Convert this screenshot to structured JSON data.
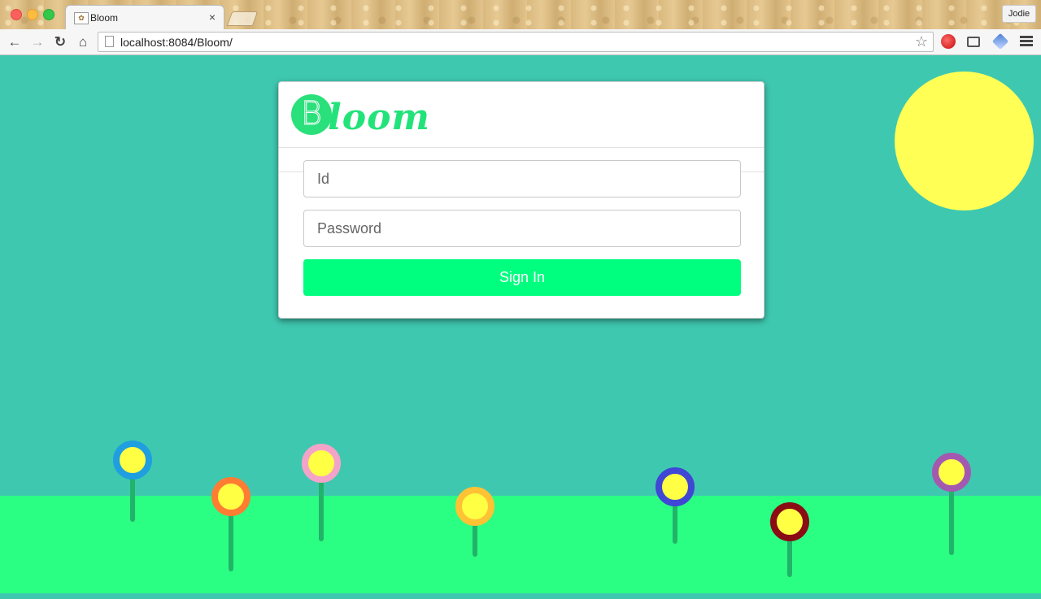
{
  "browser": {
    "tab_title": "Bloom",
    "tab_close": "×",
    "profile_name": "Jodie",
    "url": "localhost:8084/Bloom/",
    "icons": [
      "back-icon",
      "forward-icon",
      "reload-icon",
      "home-icon",
      "page-icon",
      "bookmark-star-icon",
      "extension-icon",
      "cast-icon",
      "extension-cube-icon",
      "menu-icon"
    ]
  },
  "login": {
    "logo_letter": "B",
    "logo_word": "loom",
    "id_placeholder": "Id",
    "password_placeholder": "Password",
    "signin_label": "Sign In"
  },
  "colors": {
    "sky": "#3fc8b0",
    "grass": "#2aff83",
    "sun": "#ffff55",
    "accent": "#00ff7f"
  },
  "flowers": [
    {
      "ring": "#1f9ee0"
    },
    {
      "ring": "#ff7d33"
    },
    {
      "ring": "#f4a3c8"
    },
    {
      "ring": "#ffc234"
    },
    {
      "ring": "#3f47d4"
    },
    {
      "ring": "#8a0c14"
    },
    {
      "ring": "#a459b0"
    }
  ]
}
